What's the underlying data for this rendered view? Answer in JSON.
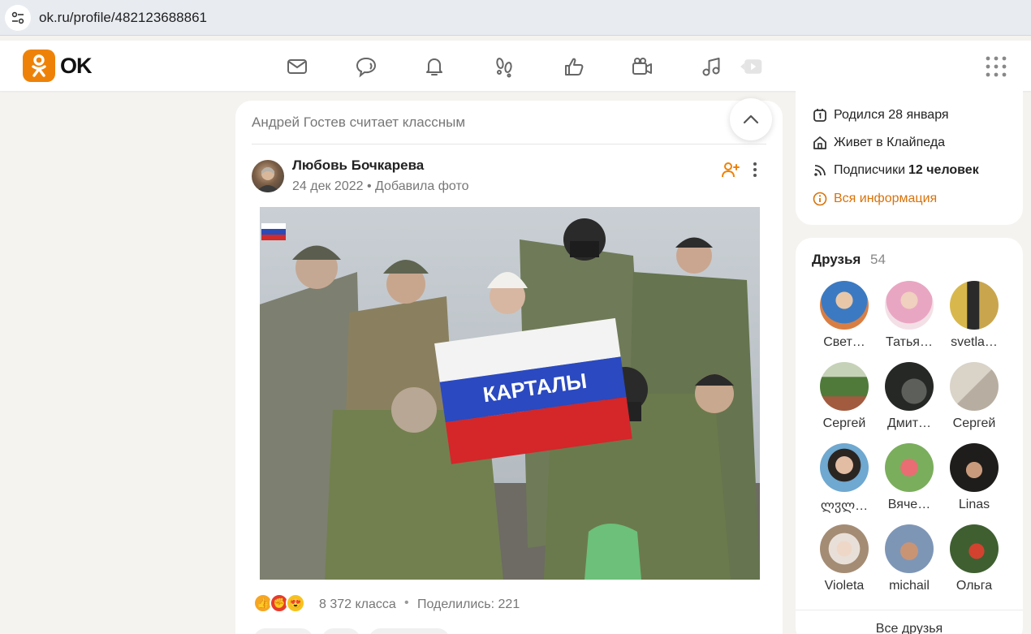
{
  "browser": {
    "url": "ok.ru/profile/482123688861"
  },
  "app": {
    "logo_text": "OK",
    "accent": "#ee8208",
    "nav_icons": [
      "messages-icon",
      "discussions-icon",
      "notifications-icon",
      "guests-icon",
      "events-icon",
      "video-icon",
      "music-icon",
      "video-play-icon",
      "apps-grid-icon"
    ]
  },
  "feed": {
    "header": "Андрей Гостев считает классным",
    "post": {
      "author": "Любовь Бочкарева",
      "meta": "24 дек 2022 • Добавила фото",
      "reactions": [
        "like",
        "super",
        "love"
      ],
      "likes": "8 372 класса",
      "separator": "•",
      "shares": "Поделились: 221"
    }
  },
  "profile_info": {
    "birthday": "Родился 28 января",
    "lives": "Живет в Клайпеда",
    "subscribers_label": "Подписчики",
    "subscribers_value": "12 человек",
    "all_info": "Вся информация"
  },
  "friends": {
    "title": "Друзья",
    "count": "54",
    "all_label": "Все друзья",
    "list": [
      {
        "name": "Свет…",
        "color": "#5aa0d8"
      },
      {
        "name": "Татья…",
        "color": "#e8b8c8"
      },
      {
        "name": "svetla…",
        "color": "#b9a469"
      },
      {
        "name": "Сергей",
        "color": "#6c8a52"
      },
      {
        "name": "Дмит…",
        "color": "#3a3b3a"
      },
      {
        "name": "Сергей",
        "color": "#c5c0b8"
      },
      {
        "name": "ლჳლ…",
        "color": "#6fa3c6"
      },
      {
        "name": "Вяче…",
        "color": "#79a860"
      },
      {
        "name": "Linas",
        "color": "#2e2a26"
      },
      {
        "name": "Violeta",
        "color": "#d8c6b4"
      },
      {
        "name": "michail",
        "color": "#8c9fb8"
      },
      {
        "name": "Ольга",
        "color": "#4b6a38"
      }
    ]
  }
}
